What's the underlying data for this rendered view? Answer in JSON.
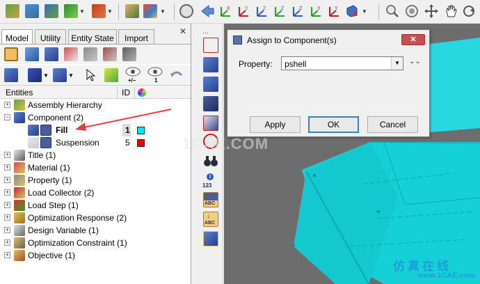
{
  "left_panel": {
    "tabs": [
      "Model",
      "Utility",
      "Entity State",
      "Import"
    ],
    "columns": {
      "entities": "Entities",
      "id": "ID"
    },
    "tree": [
      {
        "label": "Assembly Hierarchy",
        "id": "",
        "expanded": false
      },
      {
        "label": "Component (2)",
        "id": "",
        "expanded": true
      },
      {
        "label": "Fill",
        "id": "1",
        "color": "#00e5ee",
        "selected": true
      },
      {
        "label": "Suspension",
        "id": "5",
        "color": "#e00000"
      },
      {
        "label": "Title (1)",
        "id": "",
        "expanded": false
      },
      {
        "label": "Material (1)",
        "id": "",
        "expanded": false
      },
      {
        "label": "Property (1)",
        "id": "",
        "expanded": false
      },
      {
        "label": "Load Collector (2)",
        "id": "",
        "expanded": false
      },
      {
        "label": "Load Step (1)",
        "id": "",
        "expanded": false
      },
      {
        "label": "Optimization Response (2)",
        "id": "",
        "expanded": false
      },
      {
        "label": "Design Variable (1)",
        "id": "",
        "expanded": false
      },
      {
        "label": "Optimization Constraint (1)",
        "id": "",
        "expanded": false
      },
      {
        "label": "Objective (1)",
        "id": "",
        "expanded": false
      }
    ],
    "toolbar_badges": {
      "show_hide": "+/–",
      "count": "1"
    }
  },
  "vertical_toolbar": {
    "id_badge": "123",
    "abc_labels": [
      "ABC",
      "ABC"
    ]
  },
  "dialog": {
    "title": "Assign to Component(s)",
    "property_label": "Property:",
    "property_value": "pshell",
    "buttons": {
      "apply": "Apply",
      "ok": "OK",
      "cancel": "Cancel"
    }
  },
  "watermarks": {
    "center": "1CAE.COM",
    "brand": "仿真在线",
    "site": "www.1CAE.com"
  },
  "colors": {
    "mesh": "#16d8e0",
    "arrow": "#e04040",
    "background_gray": "#6d6d6d"
  }
}
